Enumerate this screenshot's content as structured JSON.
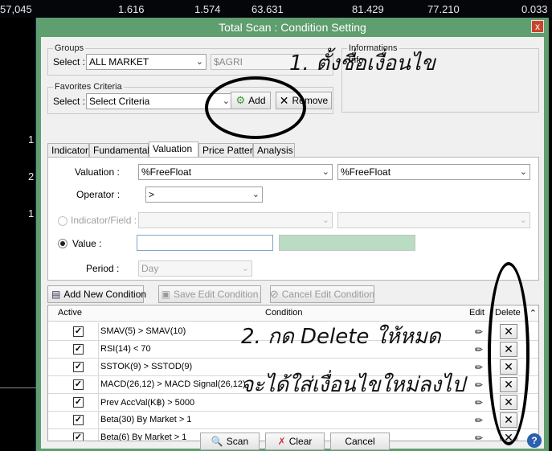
{
  "ticker": [
    "57,045",
    "1.616",
    "1.574",
    "63.631",
    "81.429",
    "77.210",
    "0.033"
  ],
  "side_numbers": [
    "1",
    "2",
    "1"
  ],
  "window": {
    "title": "Total Scan : Condition Setting",
    "close_label": "x"
  },
  "groups": {
    "legend": "Groups",
    "select_label": "Select :",
    "selected": "ALL MARKET",
    "symbol": "$AGRI"
  },
  "informations": {
    "legend": "Informations",
    "text": "Info"
  },
  "favorites": {
    "legend": "Favorites Criteria",
    "select_label": "Select :",
    "selected": "Select Criteria",
    "add_label": "Add",
    "remove_label": "Remove"
  },
  "tabs": [
    {
      "label": "Indicator"
    },
    {
      "label": "Fundamental"
    },
    {
      "label": "Valuation"
    },
    {
      "label": "Price Pattern"
    },
    {
      "label": "Analysis"
    }
  ],
  "valuation": {
    "valuation_label": "Valuation :",
    "valuation_value": "%FreeFloat",
    "valuation_value2": "%FreeFloat",
    "operator_label": "Operator :",
    "operator_value": ">",
    "indicator_label": "Indicator/Field :",
    "value_label": "Value :",
    "period_label": "Period :",
    "period_value": "Day"
  },
  "actions": {
    "add_new": "Add New Condition",
    "save_edit": "Save Edit Condition",
    "cancel_edit": "Cancel Edit Condition"
  },
  "grid": {
    "headers": {
      "active": "Active",
      "condition": "Condition",
      "edit": "Edit",
      "delete": "Delete"
    },
    "rows": [
      {
        "condition": "SMAV(5) > SMAV(10)"
      },
      {
        "condition": "RSI(14) < 70"
      },
      {
        "condition": "SSTOK(9) > SSTOD(9)"
      },
      {
        "condition": "MACD(26,12) > MACD Signal(26,12)"
      },
      {
        "condition": "Prev AccVal(K฿) > 5000"
      },
      {
        "condition": "Beta(30) By Market > 1"
      },
      {
        "condition": "Beta(6) By Market > 1"
      }
    ]
  },
  "bottom": {
    "scan": "Scan",
    "clear": "Clear",
    "cancel": "Cancel",
    "help": "?"
  },
  "annotations": {
    "step1": "1. ตั้งชื่อเงื่อนไข",
    "step2_line1": "2. กด Delete ให้หมด",
    "step2_line2": "จะได้ใส่เงื่อนไขใหม่ลงไป"
  }
}
